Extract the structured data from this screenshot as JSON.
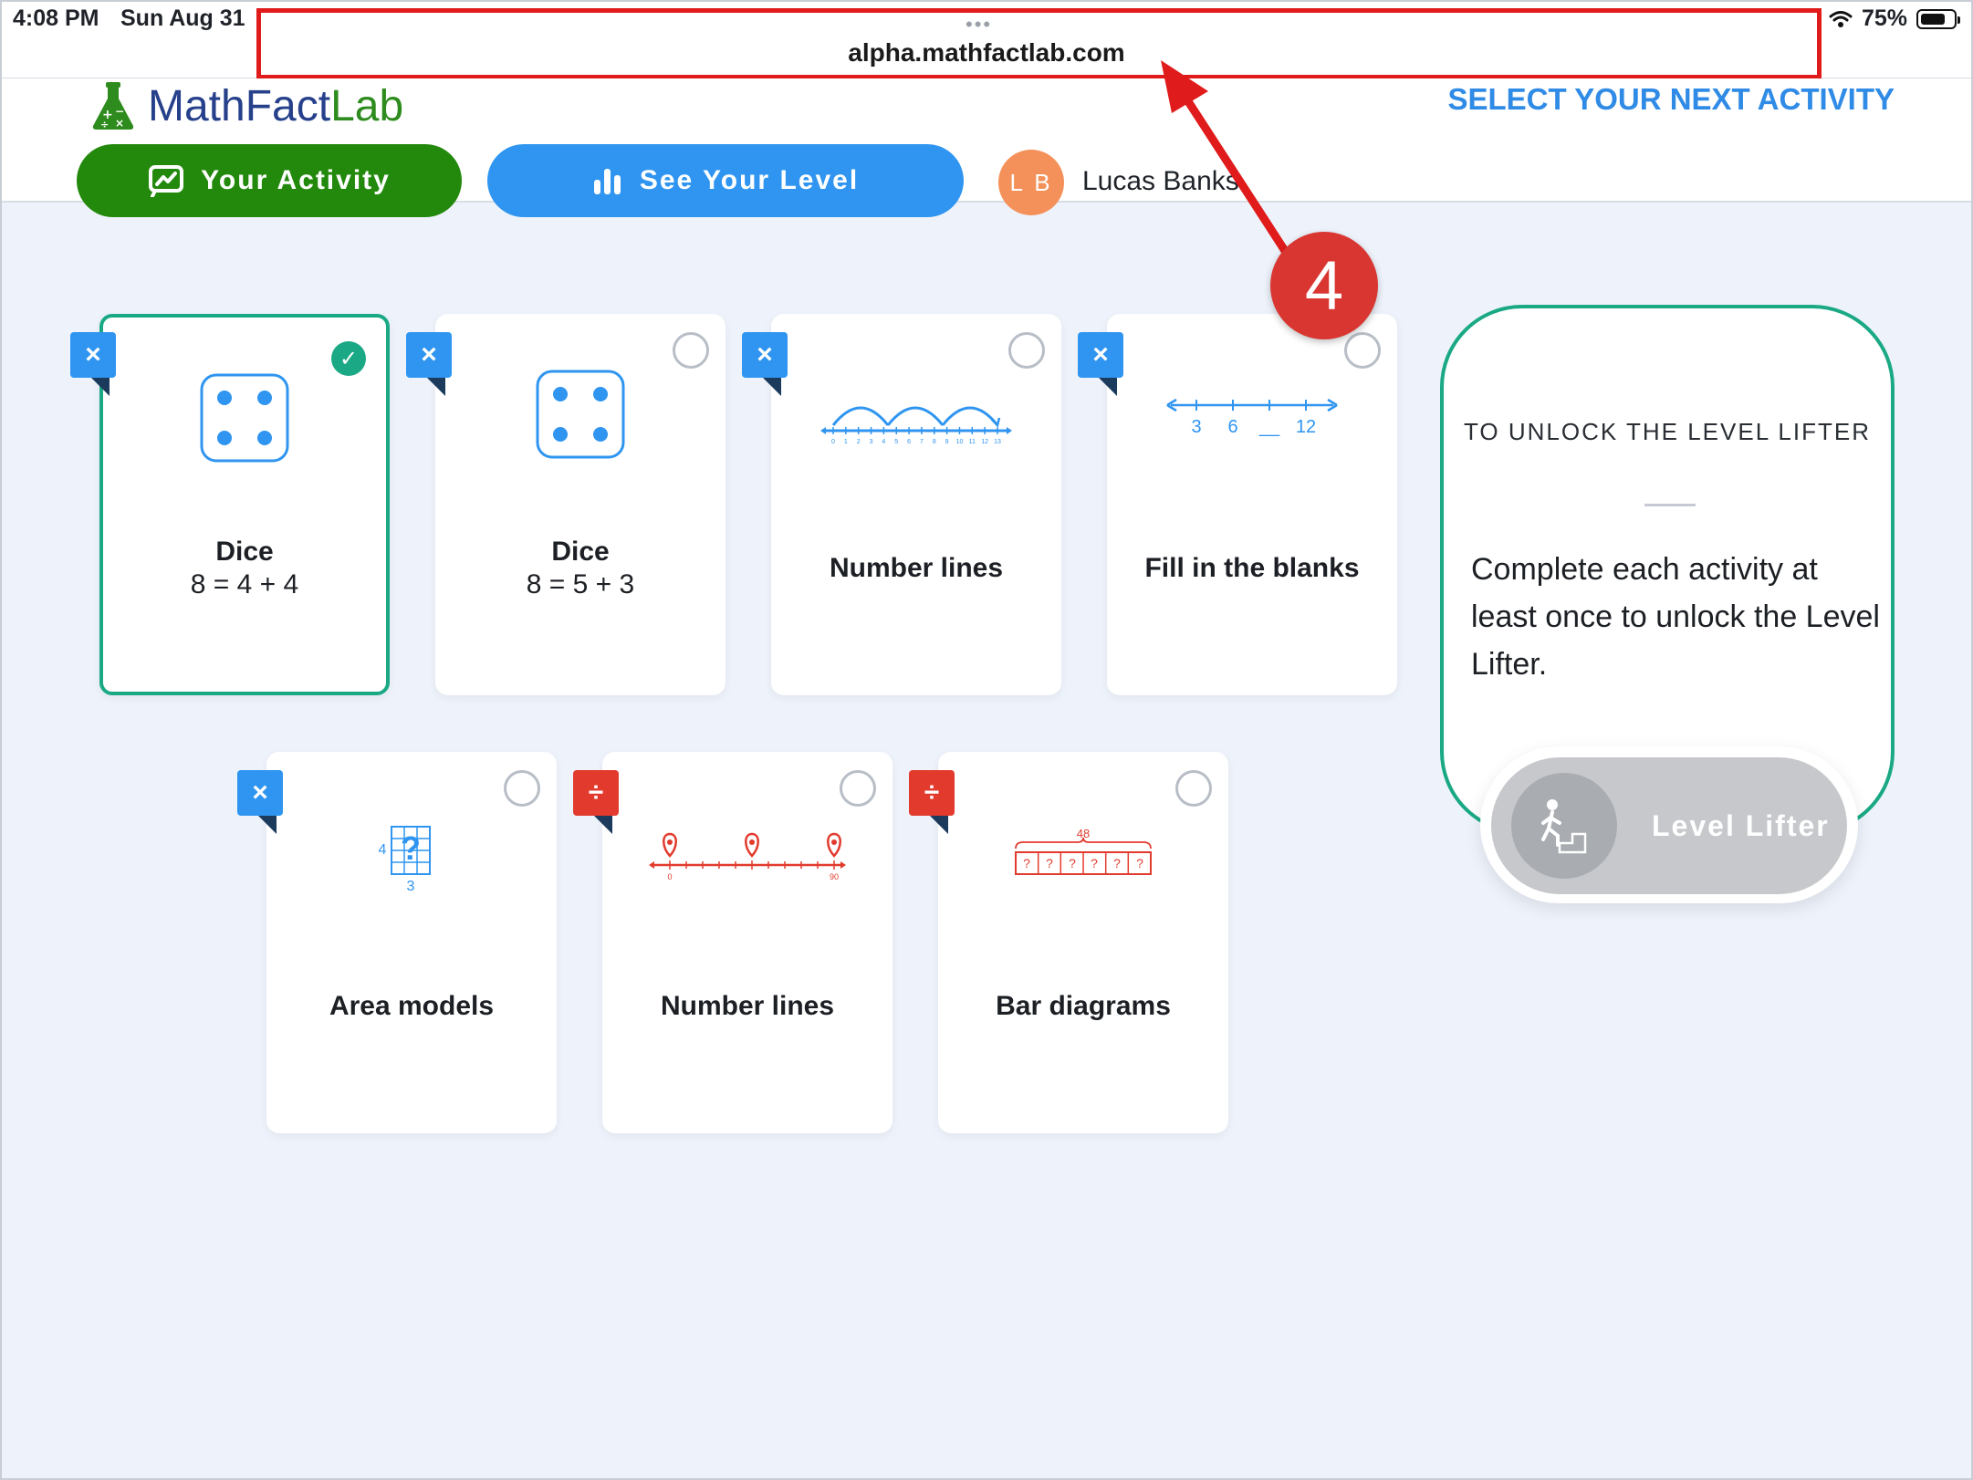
{
  "status_bar": {
    "time": "4:08 PM",
    "date": "Sun Aug 31",
    "battery": "75%",
    "battery_level": 0.75,
    "dots": "•••"
  },
  "browser": {
    "url": "alpha.mathfactlab.com"
  },
  "header": {
    "logo": {
      "name_math_fact": "MathFact",
      "name_lab": "Lab",
      "icon": "flask-icon"
    },
    "select_next": "SELECT YOUR NEXT ACTIVITY",
    "your_activity": "Your Activity",
    "see_your_level": "See Your Level",
    "avatar_initials": "L B",
    "user_name": "Lucas Banks"
  },
  "cards": [
    {
      "badge": "×",
      "badge_color": "#2f95f0",
      "title": "Dice",
      "subtitle": "8 = 4 + 4",
      "state": "completed",
      "illustration": "dice-icon"
    },
    {
      "badge": "×",
      "badge_color": "#2f95f0",
      "title": "Dice",
      "subtitle": "8 = 5 + 3",
      "state": "unselected",
      "illustration": "dice-icon"
    },
    {
      "badge": "×",
      "badge_color": "#2f95f0",
      "title": "Number lines",
      "subtitle": "",
      "state": "unselected",
      "illustration": "number-line-jumps-icon",
      "ticks": [
        "0",
        "1",
        "2",
        "3",
        "4",
        "5",
        "6",
        "7",
        "8",
        "9",
        "10",
        "11",
        "12",
        "13"
      ]
    },
    {
      "badge": "×",
      "badge_color": "#2f95f0",
      "title": "Fill in the blanks",
      "subtitle": "",
      "state": "unselected",
      "illustration": "blank-number-line-icon",
      "labels": [
        "3",
        "6",
        "__",
        "12"
      ]
    },
    {
      "badge": "×",
      "badge_color": "#2f95f0",
      "title": "Area models",
      "subtitle": "",
      "state": "unselected",
      "illustration": "area-model-icon",
      "labels": {
        "side": "4",
        "bottom": "3",
        "mark": "?"
      }
    },
    {
      "badge": "÷",
      "badge_color": "#e23b2e",
      "title": "Number lines",
      "subtitle": "",
      "state": "unselected",
      "illustration": "number-line-pins-icon",
      "labels": {
        "start": "0",
        "end": "90"
      }
    },
    {
      "badge": "÷",
      "badge_color": "#e23b2e",
      "title": "Bar diagrams",
      "subtitle": "",
      "state": "unselected",
      "illustration": "bar-diagram-icon",
      "labels": {
        "total": "48",
        "cell": "?"
      }
    }
  ],
  "panel": {
    "heading": "TO UNLOCK THE LEVEL LIFTER",
    "body": "Complete each activity at least once to unlock the Level Lifter.",
    "button_label": "Level Lifter",
    "button_icon": "stairs-climber-icon"
  },
  "annotation": {
    "number": "4",
    "color": "#e01b1b"
  }
}
